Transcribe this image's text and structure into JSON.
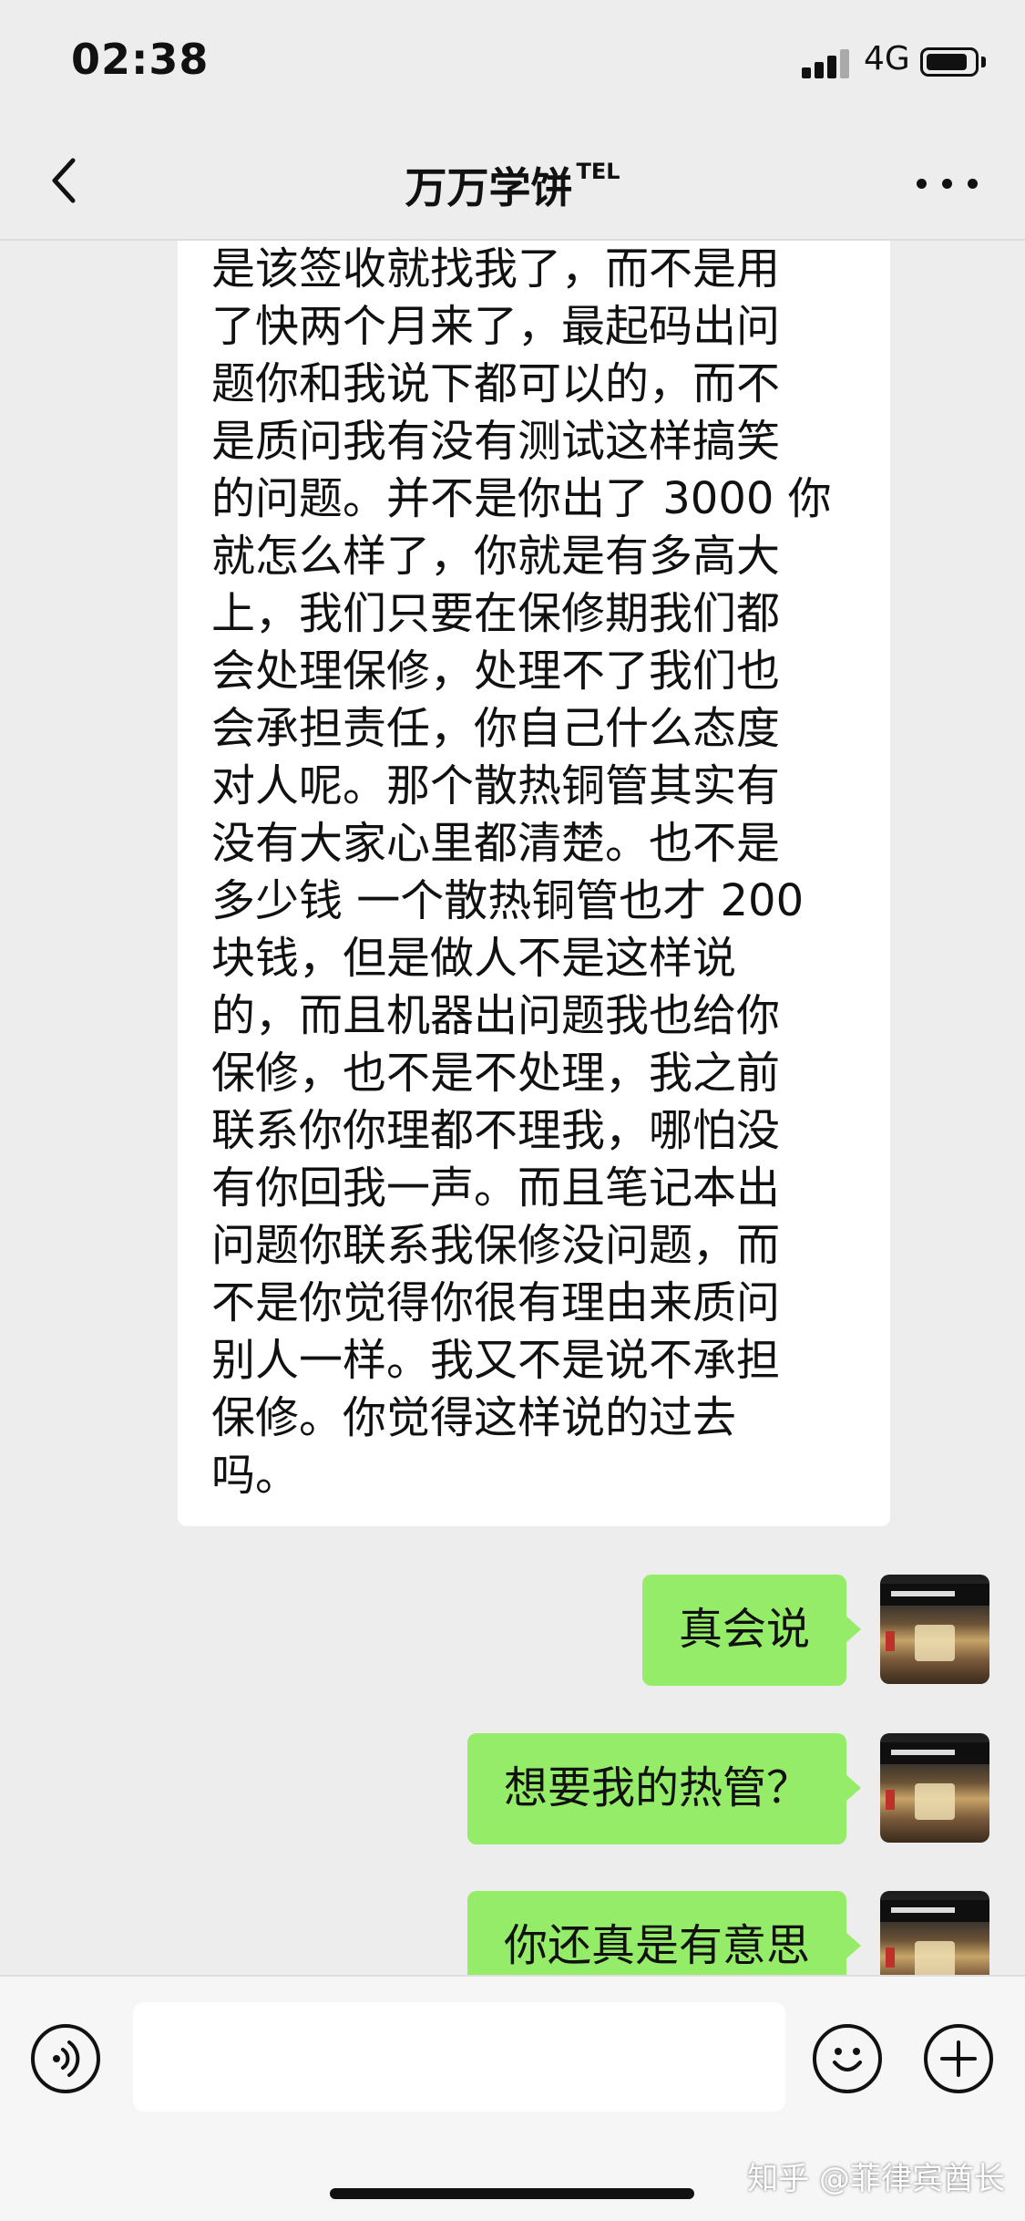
{
  "status_bar": {
    "time": "02:38",
    "network": "4G"
  },
  "nav": {
    "title": "万万学饼",
    "title_badge": "TEL"
  },
  "incoming_message": {
    "lines": [
      "是该签收就找我了，而不是用",
      "了快两个月来了，最起码出问",
      "题你和我说下都可以的，而不",
      "是质问我有没有测试这样搞笑",
      "的问题。并不是你出了 3000 你",
      "就怎么样了，你就是有多高大",
      "上，我们只要在保修期我们都",
      "会处理保修，处理不了我们也",
      "会承担责任，你自己什么态度",
      "对人呢。那个散热铜管其实有",
      "没有大家心里都清楚。也不是",
      "多少钱 一个散热铜管也才 200",
      "块钱，但是做人不是这样说",
      "的，而且机器出问题我也给你",
      "保修，也不是不处理，我之前",
      "联系你你理都不理我，哪怕没",
      "有你回我一声。而且笔记本出",
      "问题你联系我保修没问题，而",
      "不是你觉得你很有理由来质问",
      "别人一样。我又不是说不承担",
      "保修。你觉得这样说的过去",
      "吗。"
    ]
  },
  "outgoing_messages": [
    {
      "text": "真会说"
    },
    {
      "text": "想要我的热管？"
    },
    {
      "text": "你还真是有意思"
    }
  ],
  "input": {
    "placeholder": ""
  },
  "watermark": "知乎 @菲律宾酋长",
  "colors": {
    "outgoing_bubble": "#95ec69",
    "background": "#ededed",
    "incoming_bubble": "#ffffff"
  },
  "icons": {
    "back": "chevron-left-icon",
    "more": "more-horizontal-icon",
    "voice": "voice-input-icon",
    "emoji": "emoji-icon",
    "plus": "plus-icon"
  }
}
